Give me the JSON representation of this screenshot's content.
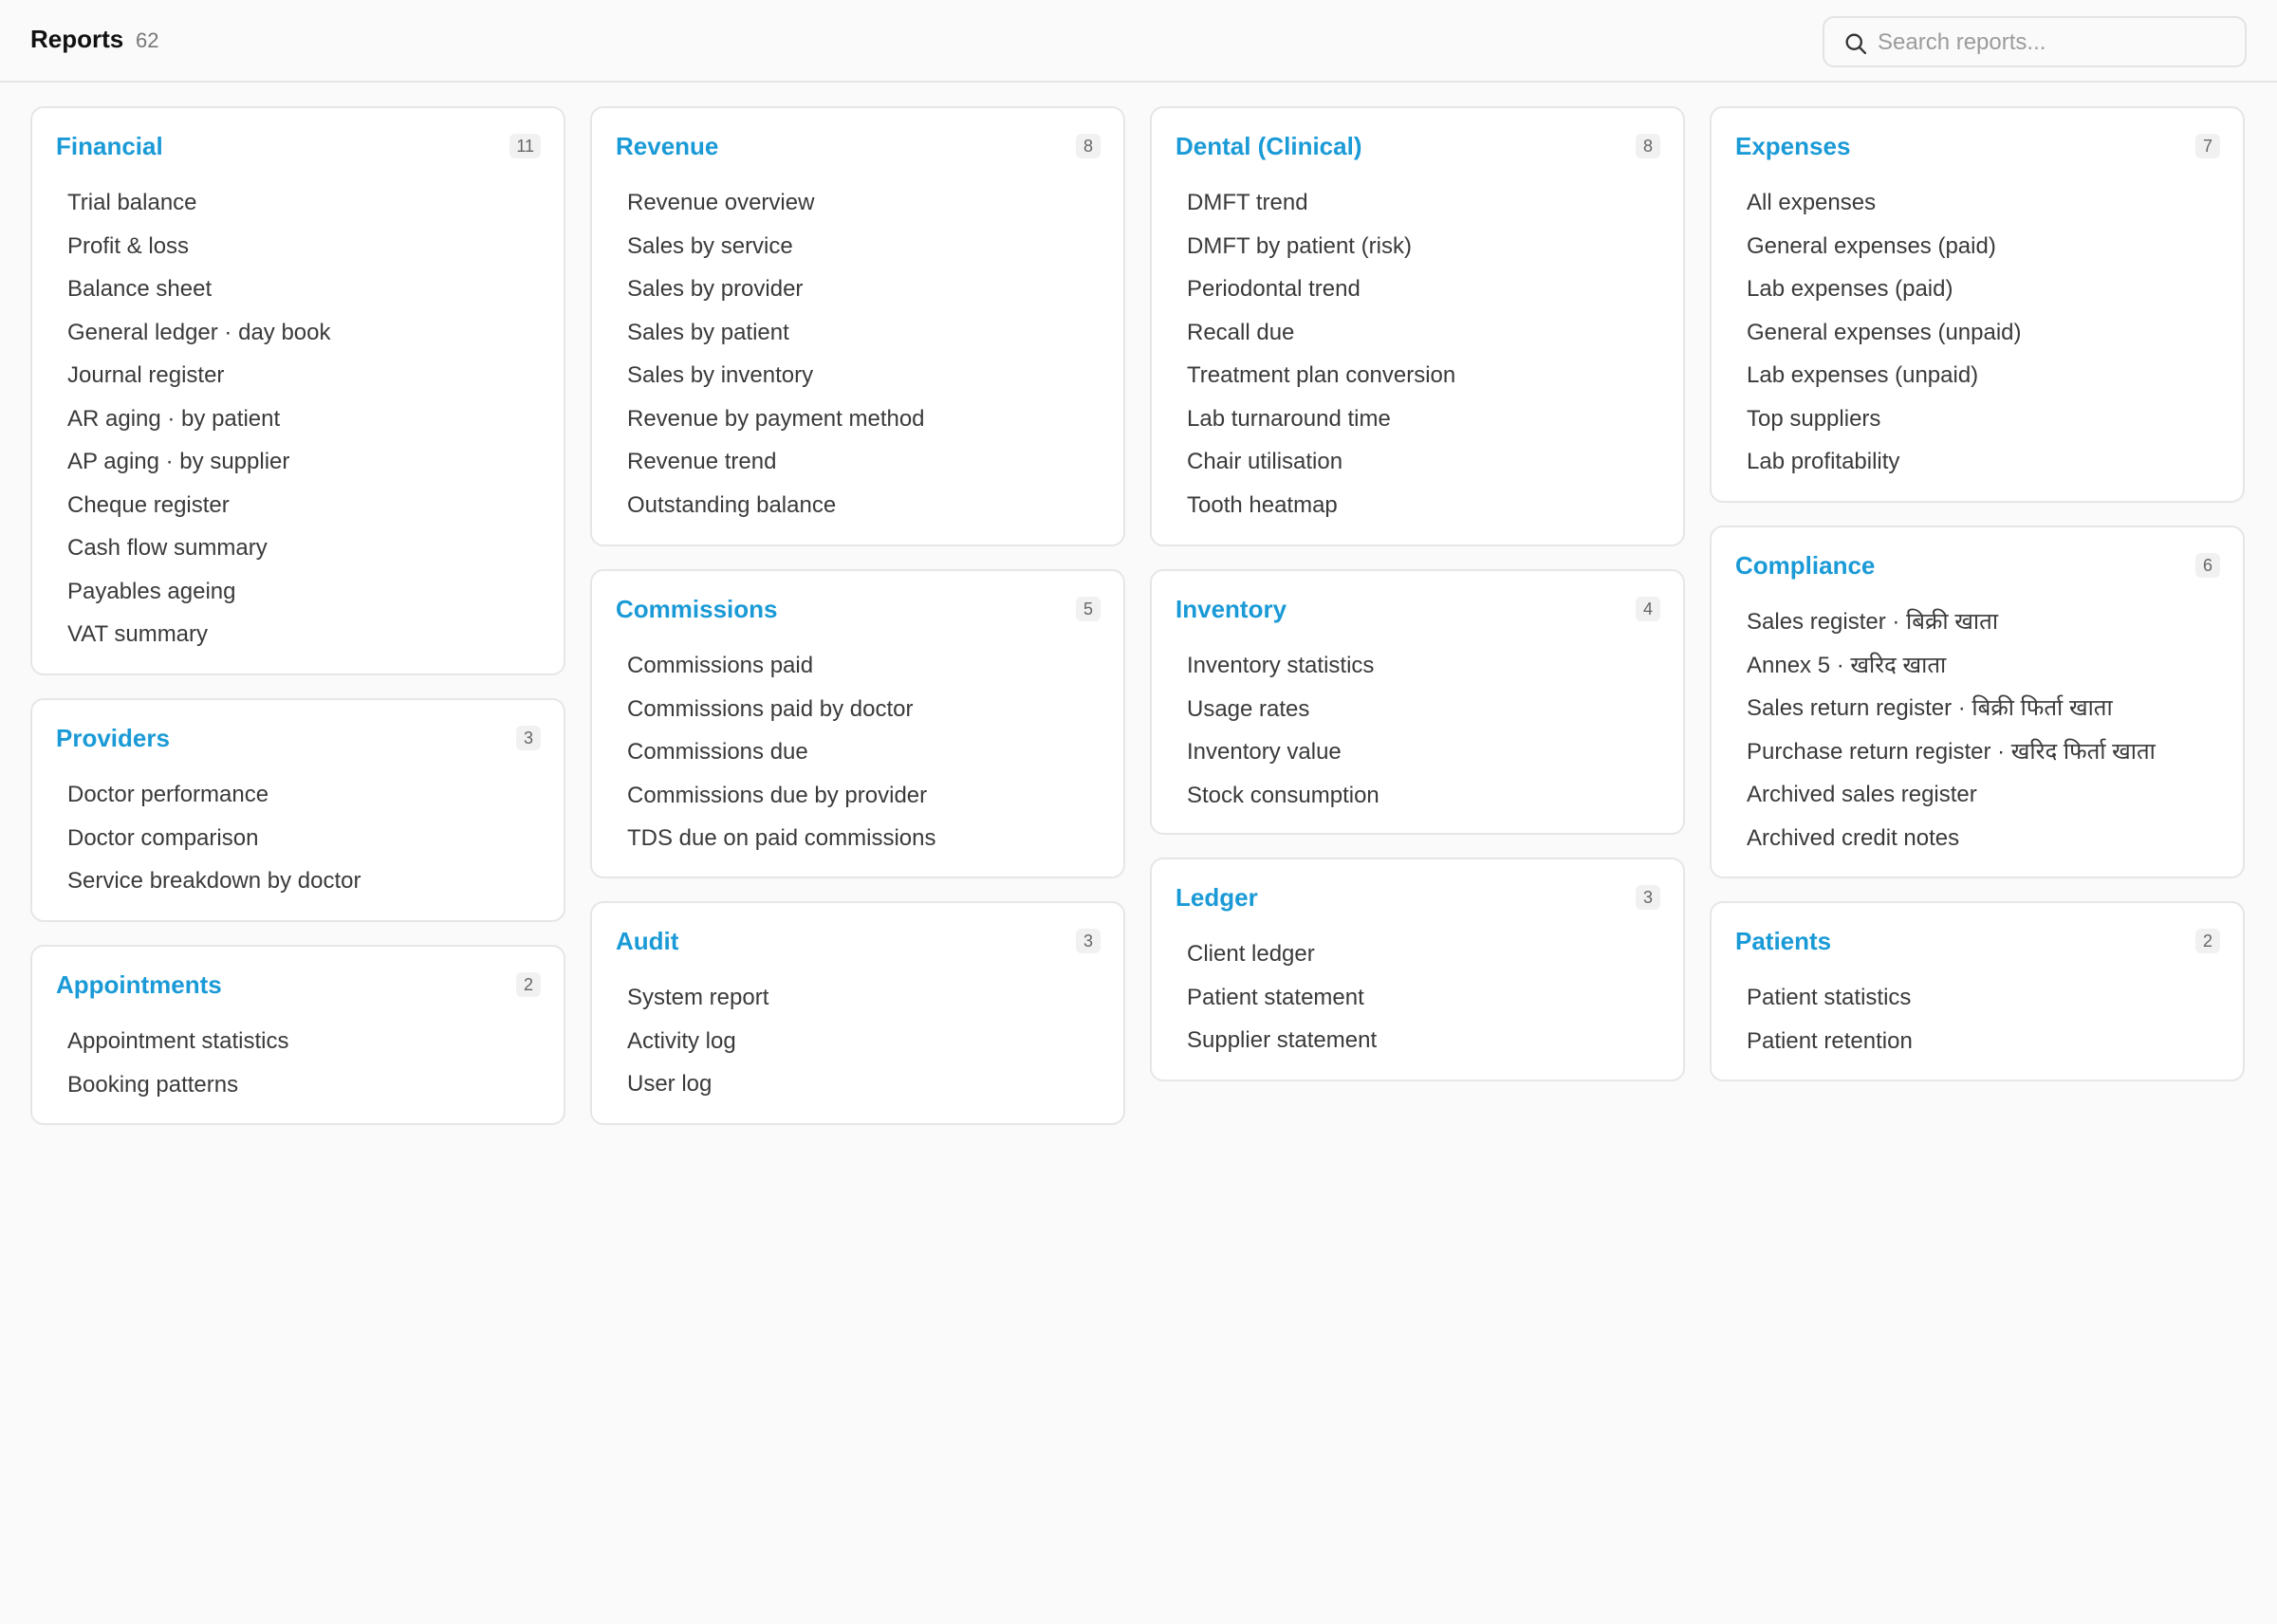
{
  "header": {
    "title": "Reports",
    "count": "62",
    "search_placeholder": "Search reports..."
  },
  "categories": [
    {
      "title": "Financial",
      "count": "11",
      "items": [
        "Trial balance",
        "Profit & loss",
        "Balance sheet",
        "General ledger · day book",
        "Journal register",
        "AR aging · by patient",
        "AP aging · by supplier",
        "Cheque register",
        "Cash flow summary",
        "Payables ageing",
        "VAT summary"
      ]
    },
    {
      "title": "Providers",
      "count": "3",
      "items": [
        "Doctor performance",
        "Doctor comparison",
        "Service breakdown by doctor"
      ]
    },
    {
      "title": "Appointments",
      "count": "2",
      "items": [
        "Appointment statistics",
        "Booking patterns"
      ]
    },
    {
      "title": "Revenue",
      "count": "8",
      "items": [
        "Revenue overview",
        "Sales by service",
        "Sales by provider",
        "Sales by patient",
        "Sales by inventory",
        "Revenue by payment method",
        "Revenue trend",
        "Outstanding balance"
      ]
    },
    {
      "title": "Commissions",
      "count": "5",
      "items": [
        "Commissions paid",
        "Commissions paid by doctor",
        "Commissions due",
        "Commissions due by provider",
        "TDS due on paid commissions"
      ]
    },
    {
      "title": "Audit",
      "count": "3",
      "items": [
        "System report",
        "Activity log",
        "User log"
      ]
    },
    {
      "title": "Dental (Clinical)",
      "count": "8",
      "items": [
        "DMFT trend",
        "DMFT by patient (risk)",
        "Periodontal trend",
        "Recall due",
        "Treatment plan conversion",
        "Lab turnaround time",
        "Chair utilisation",
        "Tooth heatmap"
      ]
    },
    {
      "title": "Inventory",
      "count": "4",
      "items": [
        "Inventory statistics",
        "Usage rates",
        "Inventory value",
        "Stock consumption"
      ]
    },
    {
      "title": "Ledger",
      "count": "3",
      "items": [
        "Client ledger",
        "Patient statement",
        "Supplier statement"
      ]
    },
    {
      "title": "Expenses",
      "count": "7",
      "items": [
        "All expenses",
        "General expenses (paid)",
        "Lab expenses (paid)",
        "General expenses (unpaid)",
        "Lab expenses (unpaid)",
        "Top suppliers",
        "Lab profitability"
      ]
    },
    {
      "title": "Compliance",
      "count": "6",
      "items": [
        "Sales register · बिक्री खाता",
        "Annex 5 · खरिद खाता",
        "Sales return register · बिक्री फिर्ता खाता",
        "Purchase return register · खरिद फिर्ता खाता",
        "Archived sales register",
        "Archived credit notes"
      ]
    },
    {
      "title": "Patients",
      "count": "2",
      "items": [
        "Patient statistics",
        "Patient retention"
      ]
    }
  ]
}
